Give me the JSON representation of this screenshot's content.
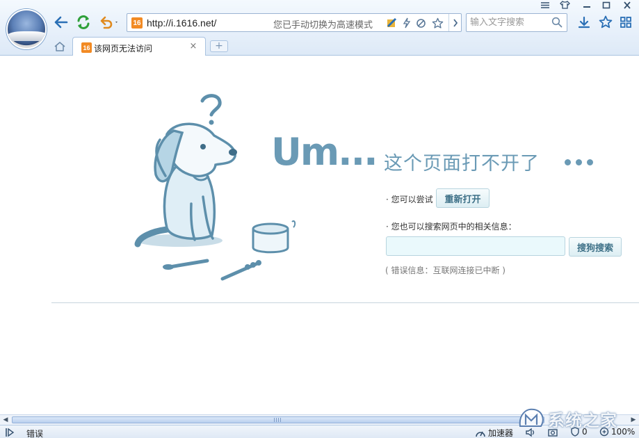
{
  "browser": {
    "url": "http://i.1616.net/",
    "mode_hint": "您已手动切换为高速模式",
    "search_placeholder": "输入文字搜索",
    "favicon_text": "16"
  },
  "tabs": [
    {
      "title": "该网页无法访问",
      "close": "×"
    }
  ],
  "new_tab_label": "+",
  "error_page": {
    "heading": "Um...",
    "subheading": "这个页面打不开了",
    "try_label": "· 您可以尝试",
    "reload_label": "重新打开",
    "search_label": "· 您也可以搜索网页中的相关信息：",
    "search_button_label": "搜狗搜索",
    "error_info": "( 错误信息：互联网连接已中断 )"
  },
  "status_bar": {
    "status_text": "错误",
    "accelerator_label": "加速器",
    "adblock_count": "0",
    "zoom": "100%"
  },
  "watermark": {
    "text": "系统之家"
  },
  "colors": {
    "accent": "#6a9ab5",
    "chrome_bg": "#dde9f7",
    "nav_blue": "#2a6fb5",
    "refresh_green": "#2fa03a",
    "undo_orange": "#e08a1e"
  }
}
